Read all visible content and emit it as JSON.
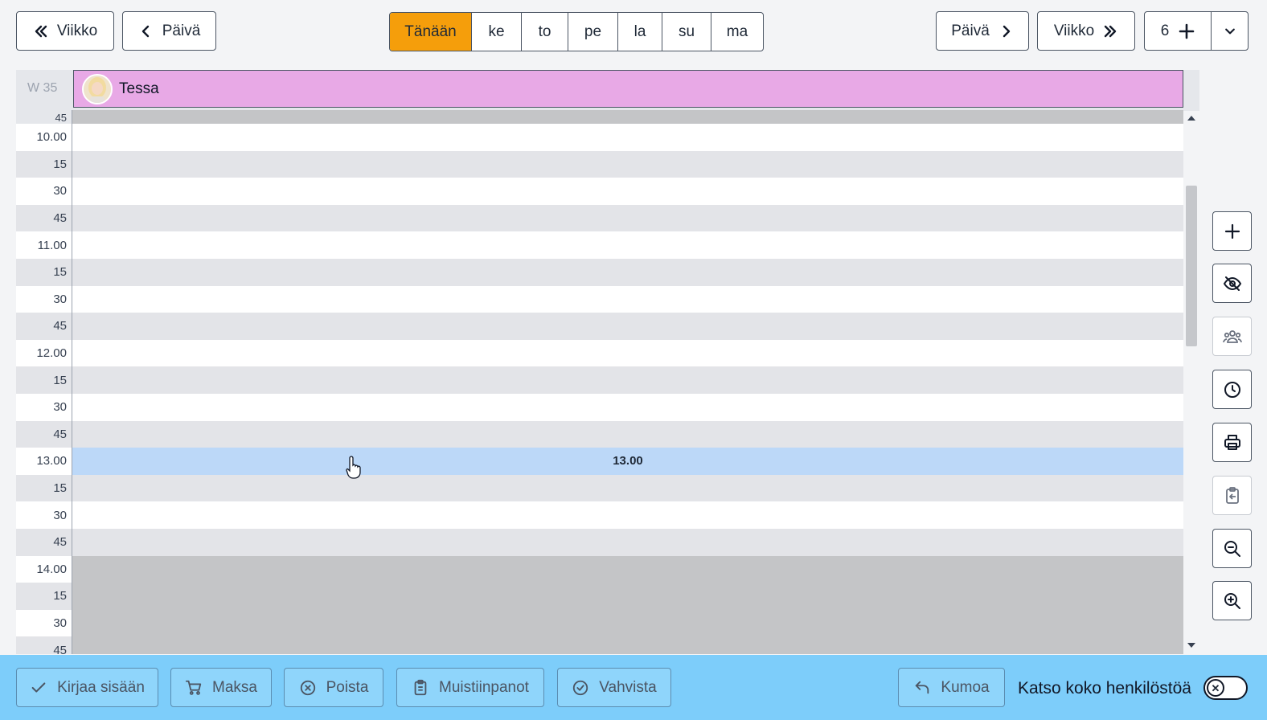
{
  "topbar": {
    "week_back_label": "Viikko",
    "day_back_label": "Päivä",
    "day_forward_label": "Päivä",
    "week_forward_label": "Viikko",
    "staff_count": "6",
    "days": [
      "Tänään",
      "ke",
      "to",
      "pe",
      "la",
      "su",
      "ma"
    ],
    "active_day_index": 0
  },
  "calendar": {
    "week_label": "W 35",
    "staff": [
      {
        "name": "Tessa",
        "color": "#e8a9e6"
      }
    ],
    "first_partial_label": "45",
    "time_labels": [
      "10.00",
      "15",
      "30",
      "45",
      "11.00",
      "15",
      "30",
      "45",
      "12.00",
      "15",
      "30",
      "45",
      "13.00",
      "15",
      "30",
      "45",
      "14.00",
      "15",
      "30",
      "45"
    ],
    "highlight_slot_index": 12,
    "highlight_label": "13.00",
    "closed_from_index": 16
  },
  "side_toolbar": [
    {
      "name": "add-icon",
      "enabled": true
    },
    {
      "name": "eye-off-icon",
      "enabled": true
    },
    {
      "name": "group-icon",
      "enabled": false
    },
    {
      "name": "clock-icon",
      "enabled": true
    },
    {
      "name": "print-icon",
      "enabled": true
    },
    {
      "name": "clipboard-paste-icon",
      "enabled": false
    },
    {
      "name": "zoom-out-icon",
      "enabled": true
    },
    {
      "name": "zoom-in-icon",
      "enabled": true
    }
  ],
  "bottombar": {
    "checkin_label": "Kirjaa sisään",
    "pay_label": "Maksa",
    "delete_label": "Poista",
    "notes_label": "Muistiinpanot",
    "confirm_label": "Vahvista",
    "undo_label": "Kumoa",
    "show_all_staff_label": "Katso koko henkilöstöä",
    "show_all_staff_on": false
  },
  "colors": {
    "accent": "#f59e0b",
    "bottom_bar": "#7dcdfa",
    "highlight_slot": "#bcd8f8"
  }
}
